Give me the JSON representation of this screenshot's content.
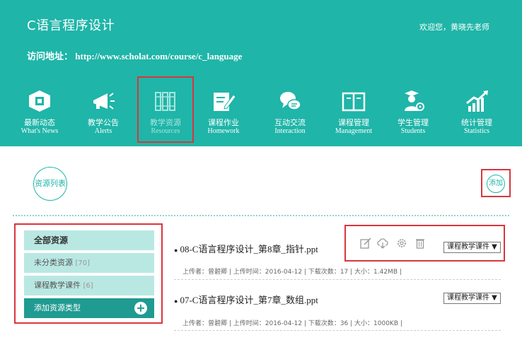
{
  "header": {
    "course_title": "C语言程序设计",
    "welcome": "欢迎您，黄晓先老师",
    "address_label": "访问地址：",
    "address_url": "http://www.scholat.com/course/c_language"
  },
  "nav": [
    {
      "cn": "最新动态",
      "en": "What's News",
      "icon": "news-box-icon"
    },
    {
      "cn": "教学公告",
      "en": "Alerts",
      "icon": "megaphone-icon"
    },
    {
      "cn": "教学资源",
      "en": "Resources",
      "icon": "books-icon",
      "active": true
    },
    {
      "cn": "课程作业",
      "en": "Homework",
      "icon": "edit-document-icon"
    },
    {
      "cn": "互动交流",
      "en": "Interaction",
      "icon": "chat-bubbles-icon"
    },
    {
      "cn": "课程管理",
      "en": "Management",
      "icon": "open-book-icon"
    },
    {
      "cn": "学生管理",
      "en": "Students",
      "icon": "student-gear-icon"
    },
    {
      "cn": "统计管理",
      "en": "Statistics",
      "icon": "bar-chart-icon"
    }
  ],
  "main": {
    "list_label": "资源列表",
    "add_label": "添加"
  },
  "sidebar": {
    "all": "全部资源",
    "uncategorized": {
      "label": "未分类资源",
      "count": "[70]"
    },
    "course_ware": {
      "label": "课程教学课件",
      "count": "[6]"
    },
    "add_type": "添加资源类型"
  },
  "resources": [
    {
      "title": "08-C语言程序设计_第8章_指针.ppt",
      "meta": "上传者：曾碧卿 | 上传时间：2016-04-12 | 下载次数：17 | 大小：1.42MB |",
      "type": "课程教学课件 ▼"
    },
    {
      "title": "07-C语言程序设计_第7章_数组.ppt",
      "meta": "上传者：曾碧卿 | 上传时间：2016-04-12 | 下载次数：36 | 大小：1000KB |",
      "type": "课程教学课件 ▼"
    }
  ],
  "colors": {
    "accent": "#1fb5a8",
    "highlight": "#d9363e",
    "sidebar_light": "#b9e8e3",
    "sidebar_dark": "#1f9b91"
  }
}
